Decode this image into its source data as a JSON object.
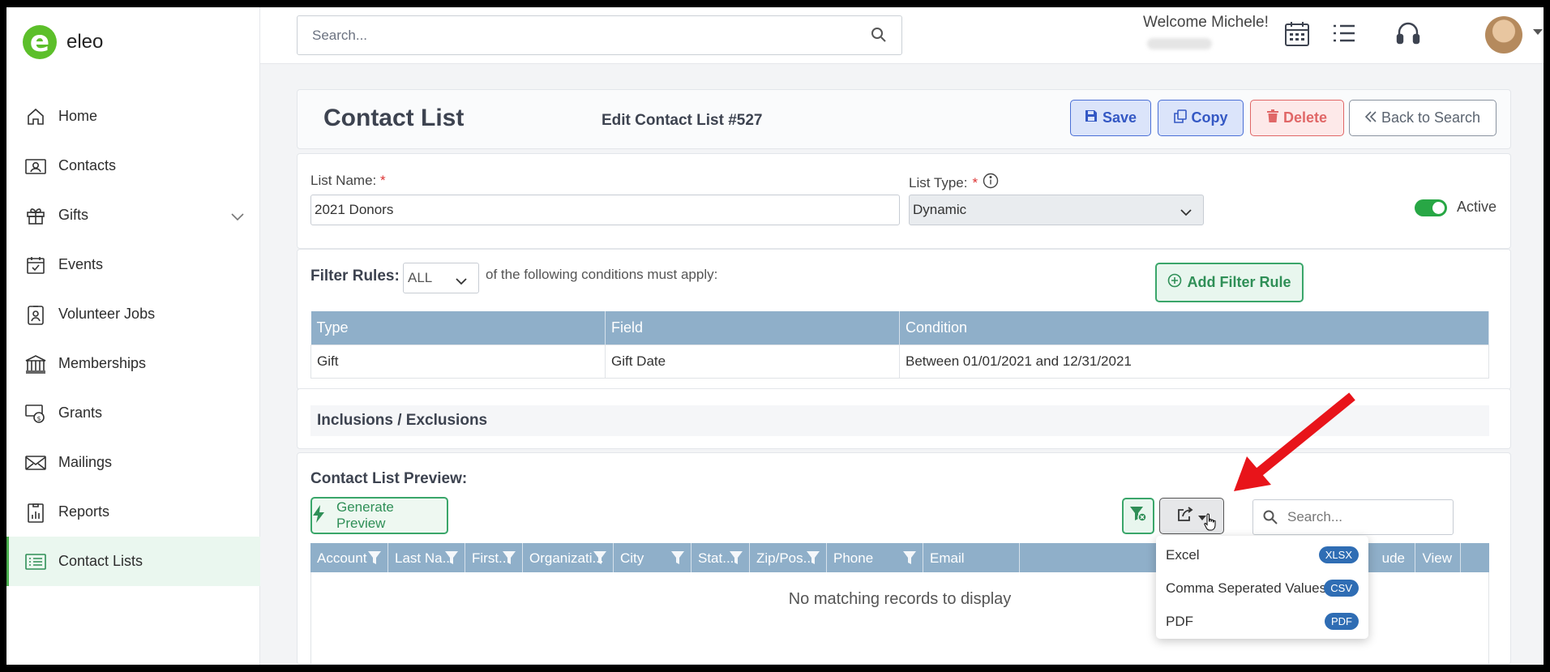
{
  "app": {
    "name": "eleo"
  },
  "colors": {
    "accent": "#4caf50",
    "header": "#8fafc9",
    "primary": "#3458c4",
    "danger": "#e06767"
  },
  "sidebar": {
    "items": [
      {
        "label": "Home",
        "icon": "home-icon"
      },
      {
        "label": "Contacts",
        "icon": "contact-card-icon"
      },
      {
        "label": "Gifts",
        "icon": "gift-icon"
      },
      {
        "label": "Events",
        "icon": "calendar-check-icon"
      },
      {
        "label": "Volunteer Jobs",
        "icon": "badge-icon"
      },
      {
        "label": "Memberships",
        "icon": "institution-icon"
      },
      {
        "label": "Grants",
        "icon": "money-icon"
      },
      {
        "label": "Mailings",
        "icon": "envelope-icon"
      },
      {
        "label": "Reports",
        "icon": "report-icon"
      },
      {
        "label": "Contact Lists",
        "icon": "list-icon"
      }
    ]
  },
  "topbar": {
    "search_placeholder": "Search...",
    "welcome": "Welcome Michele!"
  },
  "header": {
    "title": "Contact List",
    "subtitle": "Edit Contact List #527",
    "save": "Save",
    "copy": "Copy",
    "delete": "Delete",
    "back": "Back to Search"
  },
  "form": {
    "list_name_label": "List Name:",
    "list_name_value": "2021 Donors",
    "list_type_label": "List Type:",
    "list_type_value": "Dynamic",
    "active_label": "Active",
    "required_mark": "*"
  },
  "filter": {
    "label": "Filter Rules:",
    "match": "ALL",
    "text": "of the following conditions must apply:",
    "add_button": "Add Filter Rule",
    "columns": [
      "Type",
      "Field",
      "Condition"
    ],
    "rows": [
      [
        "Gift",
        "Gift Date",
        "Between 01/01/2021 and 12/31/2021"
      ]
    ]
  },
  "inclusions": {
    "title": "Inclusions / Exclusions"
  },
  "preview": {
    "title": "Contact List Preview:",
    "generate": "Generate Preview",
    "search_placeholder": "Search...",
    "columns": [
      "Account",
      "Last Na...",
      "First...",
      "Organizati...",
      "City",
      "Stat...",
      "Zip/Pos...",
      "Phone",
      "Email",
      "",
      "ude",
      "View"
    ],
    "empty": "No matching records to display"
  },
  "export_menu": [
    {
      "label": "Excel",
      "badge": "XLSX"
    },
    {
      "label": "Comma Seperated Values",
      "badge": "CSV"
    },
    {
      "label": "PDF",
      "badge": "PDF"
    }
  ]
}
